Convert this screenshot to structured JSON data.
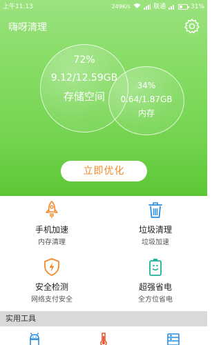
{
  "statusbar": {
    "time": "上午11:13",
    "speed": "249K/s",
    "carrier": "联通",
    "battery": "31%"
  },
  "app": {
    "title": "嗨呀清理"
  },
  "storage": {
    "percent": "72%",
    "size": "9.12/12.59GB",
    "label": "存储空间"
  },
  "memory": {
    "percent": "34%",
    "size": "0.64/1.87GB",
    "label": "内存"
  },
  "optimize_label": "立即优化",
  "features": [
    {
      "title": "手机加速",
      "subtitle": "内存清理",
      "icon": "rocket-icon"
    },
    {
      "title": "垃圾清理",
      "subtitle": "垃圾加速",
      "icon": "trash-icon"
    },
    {
      "title": "安全检测",
      "subtitle": "网络支付安全",
      "icon": "shield-lightning-icon"
    },
    {
      "title": "超强省电",
      "subtitle": "全方位省电",
      "icon": "battery-icon"
    }
  ],
  "tools_section": {
    "title": "实用工具"
  },
  "colors": {
    "accent_green": "#74d450",
    "accent_orange": "#f18a2c",
    "accent_blue": "#2a8ee0",
    "accent_teal": "#1bb39a"
  }
}
